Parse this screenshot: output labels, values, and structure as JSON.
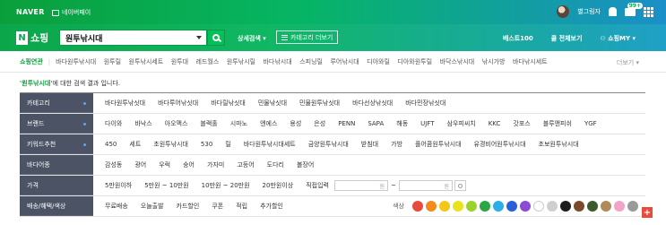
{
  "topbar": {
    "naver": "NAVER",
    "naverpay": "네이버페이",
    "user": "별그림자",
    "mail_badge": "99+"
  },
  "search": {
    "logo_n": "N",
    "logo_text": "쇼핑",
    "query": "원투낚시대",
    "detail_label": "상세검색",
    "category_more": "카테고리 더보기",
    "nav": [
      "베스트100",
      "쿨 전체보기",
      "쇼핑MY"
    ]
  },
  "related": {
    "title": "쇼핑연관",
    "items": [
      "바다원투낚시대",
      "원투릴",
      "원투낚시세트",
      "원투대",
      "레드월스",
      "원투낚시릴",
      "바다낚시대",
      "스피닝릴",
      "루어낚시대",
      "디아와릴",
      "디아와원투릴",
      "바닥스낚시대",
      "낚시가방",
      "바다낚시세트"
    ],
    "more": "더보기"
  },
  "notice": {
    "keyword": "'원투낚시대'",
    "text": "에 대한 검색 결과 입니다."
  },
  "filters": {
    "category": {
      "label": "카테고리",
      "options": [
        "바다원투낚싯대",
        "바다루어낚싯대",
        "바다릴낚싯대",
        "민물낚싯대",
        "민물원투낚싯대",
        "바다선상낚싯대",
        "바다민장낚싯대"
      ]
    },
    "brand": {
      "label": "브랜드",
      "options": [
        "다이와",
        "바낙스",
        "아오맥스",
        "블랙홀",
        "시마노",
        "엔에스",
        "용성",
        "은성",
        "PENN",
        "SAPA",
        "해동",
        "UJFT",
        "삼우피씨치",
        "KKC",
        "갓포스",
        "블루앤피쉬",
        "YGF"
      ]
    },
    "keyword": {
      "label": "키워드추천",
      "options": [
        "450",
        "세트",
        "초원투낚시대",
        "530",
        "릴",
        "바다원투낚시대세트",
        "금양원투낚시대",
        "받침대",
        "가방",
        "플어콤원투낚시대",
        "유경비어원투낚시대",
        "초보원투낚시대"
      ]
    },
    "target": {
      "label": "바다어종",
      "options": [
        "감성동",
        "광어",
        "우럭",
        "숭어",
        "가자미",
        "고등어",
        "도다리",
        "볼장어"
      ]
    },
    "price": {
      "label": "가격",
      "options": [
        "5만원이하",
        "5만원 ~ 10만원",
        "10만원 ~ 20만원",
        "20만원이상"
      ],
      "direct_label": "직접입력",
      "unit": "원",
      "tilde": "~"
    },
    "shipping": {
      "label": "배송/혜택/색상",
      "options": [
        "무료배송",
        "오늘출발",
        "카드할인",
        "쿠폰",
        "적립",
        "추가할인"
      ],
      "color_label": "색상"
    }
  },
  "colors": [
    "#e84b3c",
    "#f28a1e",
    "#f5c518",
    "#e8e31a",
    "#9bd12b",
    "#27a844",
    "#2eaee8",
    "#2b5fd9",
    "#8b4bd3",
    "#ffffff",
    "#cfcfcf",
    "#1e1e1e",
    "#7a4a2a",
    "#3c5a2e",
    "#b08a5a",
    "#f3a3c8",
    "#9a9a9a"
  ],
  "plus": "+"
}
